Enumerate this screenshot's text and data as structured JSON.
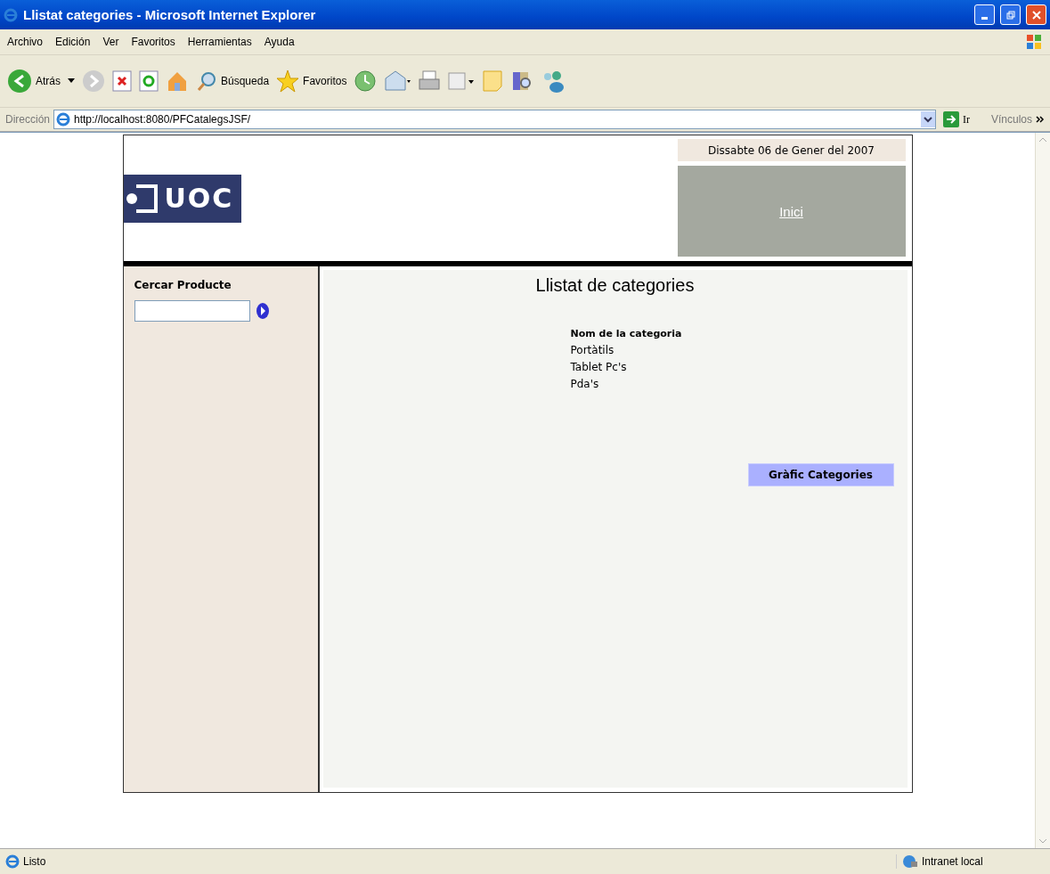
{
  "window": {
    "title": "Llistat categories - Microsoft Internet Explorer"
  },
  "menu": [
    "Archivo",
    "Edición",
    "Ver",
    "Favoritos",
    "Herramientas",
    "Ayuda"
  ],
  "toolbar": {
    "back": "Atrás",
    "search": "Búsqueda",
    "favorites": "Favoritos"
  },
  "address_bar": {
    "label": "Dirección",
    "url": "http://localhost:8080/PFCatalegsJSF/",
    "go": "Ir",
    "links": "Vínculos"
  },
  "page": {
    "logo": "UOC",
    "date": "Dissabte 06 de Gener del 2007",
    "home_link": "Inici",
    "sidebar": {
      "title": "Cercar Producte"
    },
    "main": {
      "title": "Llistat de categories",
      "column": "Nom de la categoria",
      "rows": [
        "Portàtils",
        "Tablet Pc's",
        "Pda's"
      ],
      "button": "Gràfic Categories"
    }
  },
  "status_bar": {
    "text": "Listo",
    "zone": "Intranet local"
  }
}
